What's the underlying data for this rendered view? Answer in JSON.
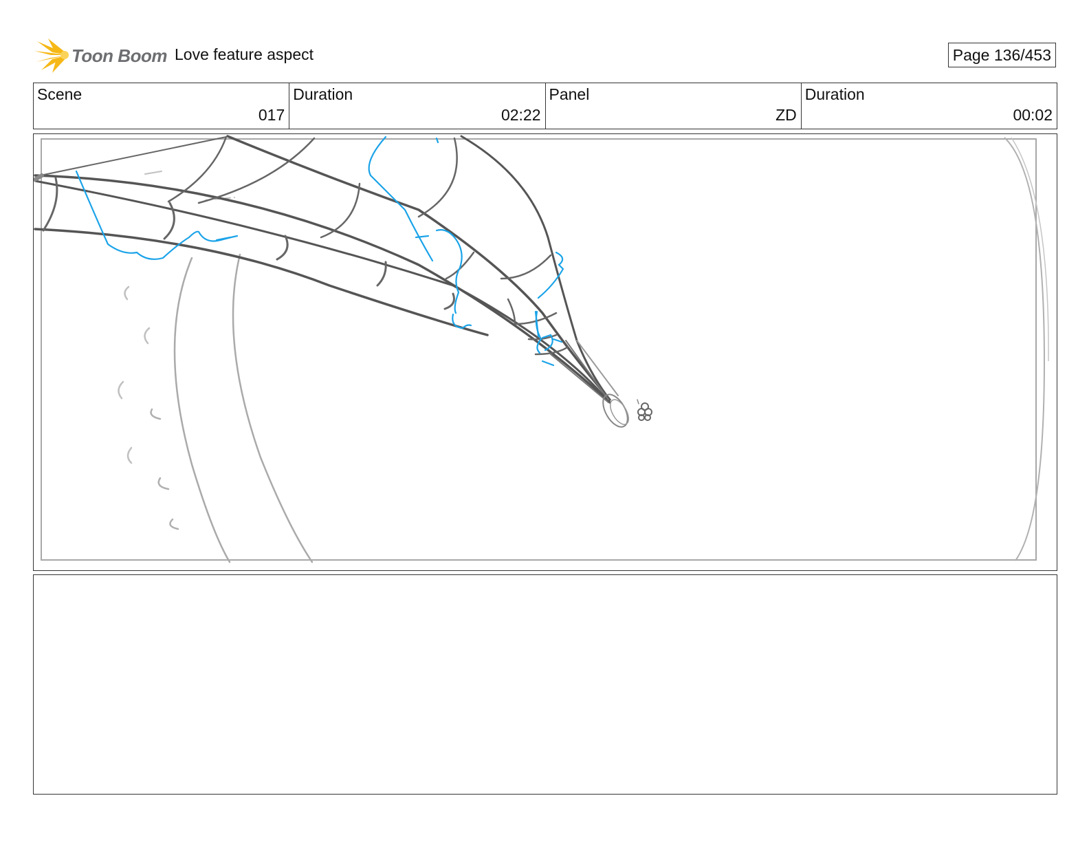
{
  "header": {
    "logo_text": "Toon Boom",
    "project_title": "Love feature aspect",
    "page_label": "Page 136/453"
  },
  "info": {
    "scene_label": "Scene",
    "scene_value": "017",
    "scene_duration_label": "Duration",
    "scene_duration_value": "02:22",
    "panel_label": "Panel",
    "panel_value": "ZD",
    "panel_duration_label": "Duration",
    "panel_duration_value": "00:02"
  },
  "colors": {
    "sketch_gray": "#555555",
    "sketch_light": "#9a9a9a",
    "sketch_blue": "#1aa3e8",
    "logo_yellow": "#f6b817"
  }
}
